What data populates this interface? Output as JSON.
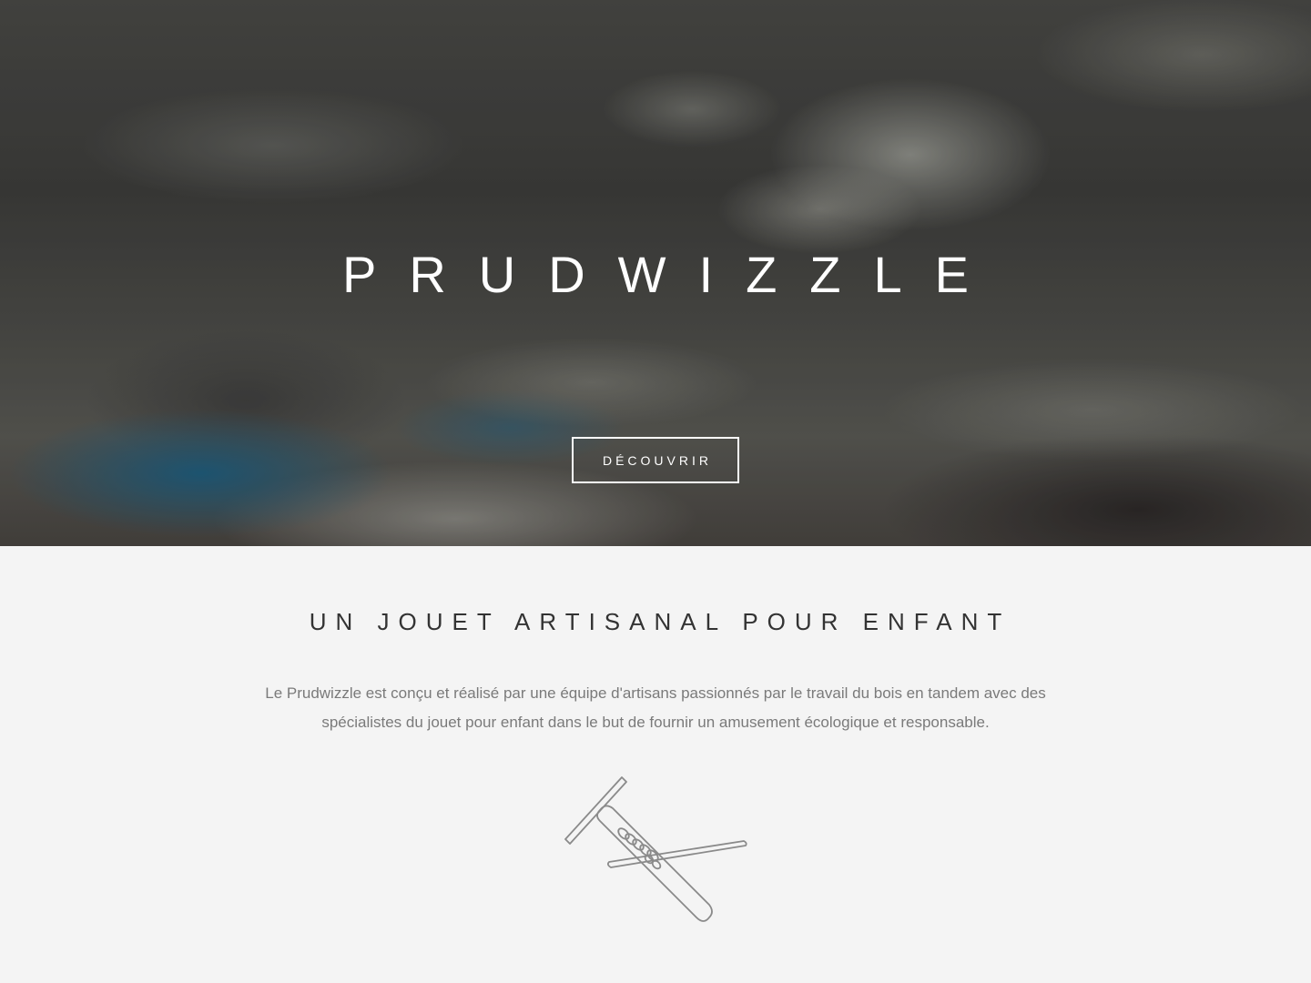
{
  "hero": {
    "title": "PRUDWIZZLE",
    "button_label": "DÉCOUVRIR"
  },
  "about": {
    "heading": "UN JOUET ARTISANAL POUR ENFANT",
    "text": "Le Prudwizzle est conçu et réalisé par une équipe d'artisans passionnés par le travail du bois en tandem avec des spécialistes du jouet pour enfant dans le but de fournir un amusement écologique et responsable.",
    "illustration_icon": "wooden-toy-icon"
  },
  "colors": {
    "hero_text": "#ffffff",
    "section_background": "#f4f4f4",
    "heading": "#333333",
    "body_text": "#7a7a7a",
    "illustration_stroke": "#8a8a8a"
  }
}
